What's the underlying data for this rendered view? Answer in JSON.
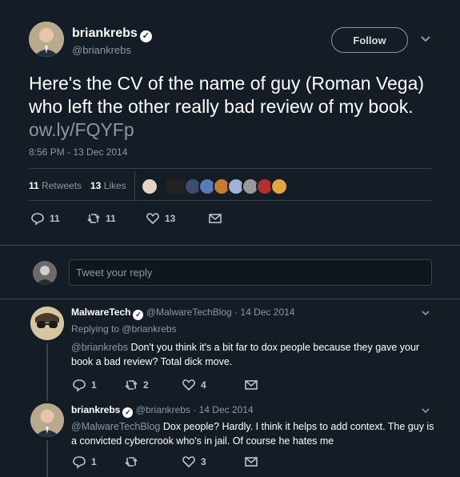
{
  "tweet": {
    "author_name": "briankrebs",
    "author_handle": "@briankrebs",
    "follow_label": "Follow",
    "text": "Here's the CV of the name of guy (Roman Vega) who left the other really bad review of my book.",
    "link": "ow.ly/FQYFp",
    "timestamp": "8:56 PM - 13 Dec 2014",
    "retweets_count": "11",
    "retweets_label": "Retweets",
    "likes_count": "13",
    "likes_label": "Likes",
    "actions": {
      "reply": "11",
      "retweet": "11",
      "like": "13"
    }
  },
  "reply_box": {
    "placeholder": "Tweet your reply"
  },
  "replies": [
    {
      "author_name": "MalwareTech",
      "author_handle": "@MalwareTechBlog",
      "date": "· 14 Dec 2014",
      "replying_to_prefix": "Replying to",
      "replying_to_handle": "@briankrebs",
      "mention": "@briankrebs",
      "text": "Don't you think it's a bit far to dox people because they gave your book a bad review? Total dick move.",
      "actions": {
        "reply": "1",
        "retweet": "2",
        "like": "4"
      }
    },
    {
      "author_name": "briankrebs",
      "author_handle": "@briankrebs",
      "date": "· 14 Dec 2014",
      "mention": "@MalwareTechBlog",
      "text": "Dox people? Hardly. I think it helps to add context. The guy is a convicted cybercrook who's in jail. Of course he hates me",
      "actions": {
        "reply": "1",
        "retweet": "",
        "like": "3"
      }
    }
  ],
  "colors": {
    "background": "#141d26",
    "muted": "#8899a6",
    "link": "#1da1f2",
    "border": "#38444d"
  }
}
